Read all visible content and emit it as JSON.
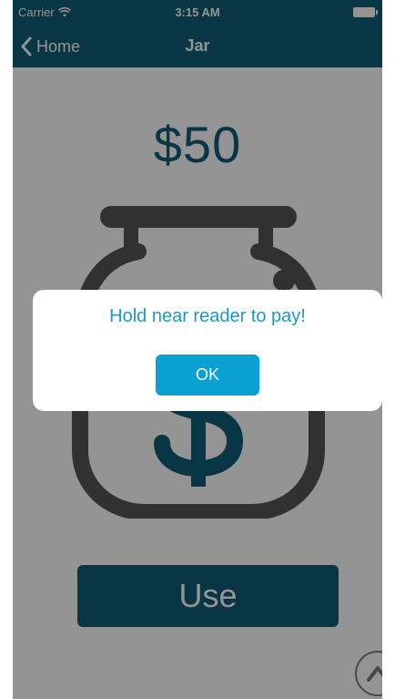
{
  "status_bar": {
    "carrier": "Carrier",
    "time": "3:15 AM",
    "wifi_icon": "wifi-icon",
    "battery_icon": "battery-icon"
  },
  "nav": {
    "back_label": "Home",
    "back_icon": "chevron-left-icon",
    "title": "Jar"
  },
  "jar": {
    "amount": "$50",
    "icon": "jar-icon",
    "use_label": "Use",
    "scroll_icon": "chevron-up-icon"
  },
  "alert": {
    "message": "Hold near reader to pay!",
    "ok_label": "OK"
  },
  "colors": {
    "brand": "#0e5d78",
    "accent": "#0aa0d2",
    "alert_text": "#1f97c6"
  }
}
